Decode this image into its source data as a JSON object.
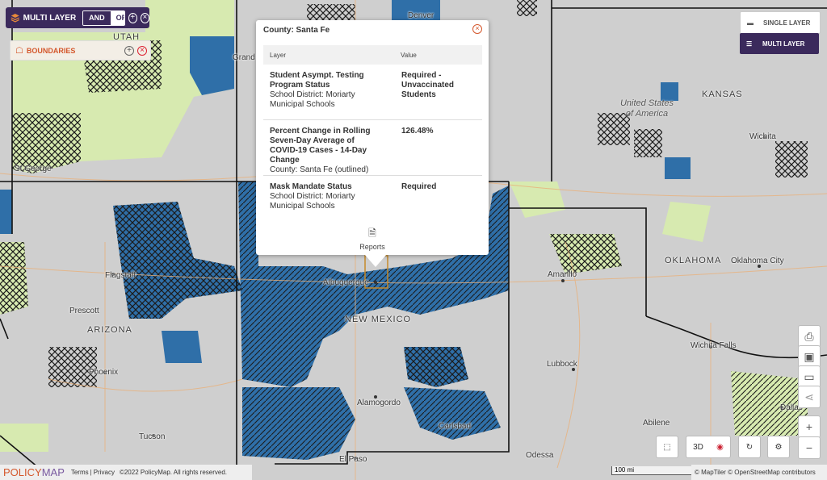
{
  "toolbar": {
    "title": "MULTI LAYER",
    "and_label": "AND",
    "or_label": "OR"
  },
  "boundaries": {
    "label": "BOUNDARIES"
  },
  "popup": {
    "title": "County: Santa Fe",
    "col_layer": "Layer",
    "col_value": "Value",
    "rows": [
      {
        "layer": "Student Asympt. Testing Program Status",
        "detail": "School District: Moriarty Municipal Schools",
        "value": "Required - Unvaccinated Students"
      },
      {
        "layer": "Percent Change in Rolling Seven-Day Average of COVID-19 Cases - 14-Day Change",
        "detail": "County: Santa Fe (outlined)",
        "value": "126.48%"
      },
      {
        "layer": "Mask Mandate Status",
        "detail": "School District: Moriarty Municipal Schools",
        "value": "Required"
      }
    ],
    "reports_label": "Reports"
  },
  "layer_toggle": {
    "single": "SINGLE LAYER",
    "multi": "MULTI LAYER"
  },
  "map_labels": {
    "utah": "UTAH",
    "grand": "Grand",
    "st_george": "St George",
    "denver": "Denver",
    "kansas": "KANSAS",
    "united_states": "United States of America",
    "wichita": "Wichita",
    "flagstaff": "Flagstaff",
    "prescott": "Prescott",
    "arizona": "ARIZONA",
    "phoenix": "Phoenix",
    "tucson": "Tucson",
    "albuquerque": "Albuquerque",
    "new_mexico": "NEW MEXICO",
    "alamogordo": "Alamogordo",
    "carlsbad": "Carlsbad",
    "el_paso": "El Paso",
    "amarillo": "Amarillo",
    "oklahoma": "OKLAHOMA",
    "oklahoma_city": "Oklahoma City",
    "wichita_falls": "Wichita Falls",
    "lubbock": "Lubbock",
    "abilene": "Abilene",
    "odessa": "Odessa",
    "dallas": "Dallas"
  },
  "controls": {
    "three_d": "3D",
    "zoom_in": "+",
    "zoom_out": "−",
    "scale": "100 mi"
  },
  "footer": {
    "logo_policy": "POLICY",
    "logo_map": "MAP",
    "terms": "Terms",
    "sep": "|",
    "privacy": "Privacy",
    "copyright": "©2022 PolicyMap. All rights reserved.",
    "attribution": "© MapTiler © OpenStreetMap contributors"
  },
  "colors": {
    "accent": "#3b2a5c",
    "blue_fill": "#2f6fa8",
    "hatch": "#1b1b1b",
    "green_fill": "#d7eab0",
    "orange": "#d4572c"
  }
}
